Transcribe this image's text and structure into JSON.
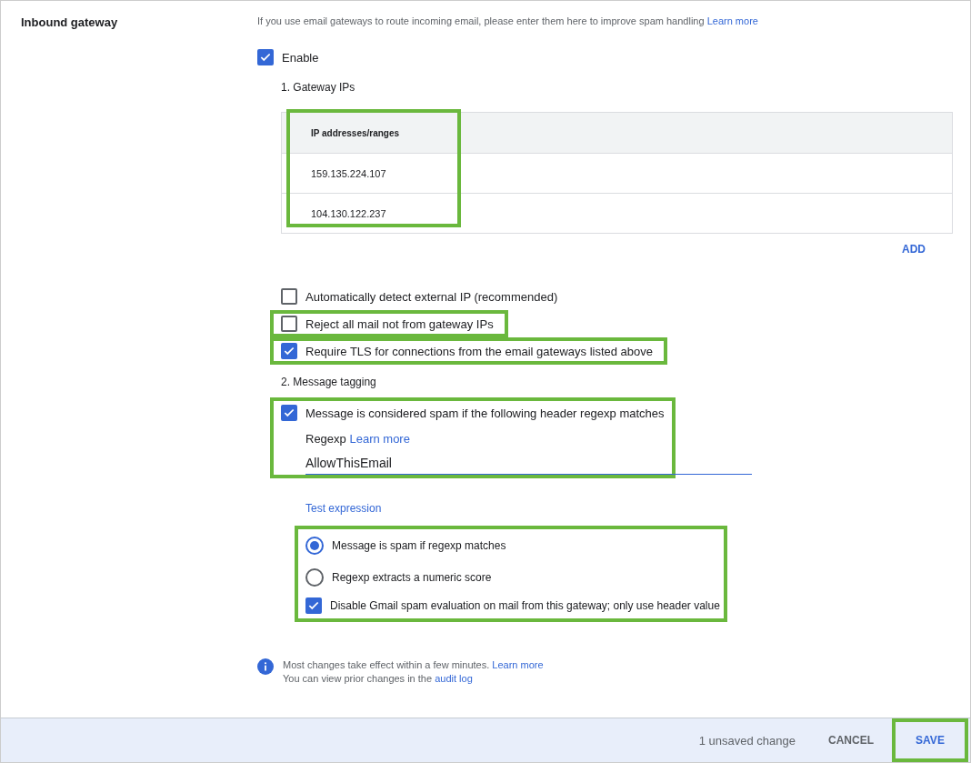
{
  "section": {
    "label": "Inbound gateway",
    "description": "If you use email gateways to route incoming email, please enter them here to improve spam handling",
    "description_link": "Learn more"
  },
  "enable": {
    "label": "Enable",
    "checked": true
  },
  "gateway_ips": {
    "heading": "1. Gateway IPs",
    "column": "IP addresses/ranges",
    "rows": [
      "159.135.224.107",
      "104.130.122.237"
    ],
    "highlighted": true,
    "add_button": "ADD"
  },
  "options": [
    {
      "label": "Automatically detect external IP (recommended)",
      "checked": false,
      "highlighted": false
    },
    {
      "label": "Reject all mail not from gateway IPs",
      "checked": false,
      "highlighted": true
    },
    {
      "label": "Require TLS for connections from the email gateways listed above",
      "checked": true,
      "highlighted": true
    }
  ],
  "tagging": {
    "heading": "2. Message tagging",
    "rule": {
      "label": "Message is considered spam if the following header regexp matches",
      "checked": true,
      "highlighted": true
    },
    "regexp_label": "Regexp",
    "regexp_link": "Learn more",
    "value": "AllowThisEmail",
    "test_link": "Test expression",
    "choices_highlighted": true,
    "choices": [
      {
        "kind": "radio",
        "label": "Message is spam if regexp matches",
        "selected": true
      },
      {
        "kind": "radio",
        "label": "Regexp extracts a numeric score",
        "selected": false
      },
      {
        "kind": "checkbox",
        "label": "Disable Gmail spam evaluation on mail from this gateway; only use header value",
        "checked": true
      }
    ]
  },
  "info": {
    "line1": "Most changes take effect within a few minutes.",
    "line1_link": "Learn more",
    "line2": "You can view prior changes in the",
    "line2_link": "audit log"
  },
  "footer": {
    "status": "1 unsaved change",
    "cancel": "CANCEL",
    "save": "SAVE",
    "save_highlighted": true
  }
}
